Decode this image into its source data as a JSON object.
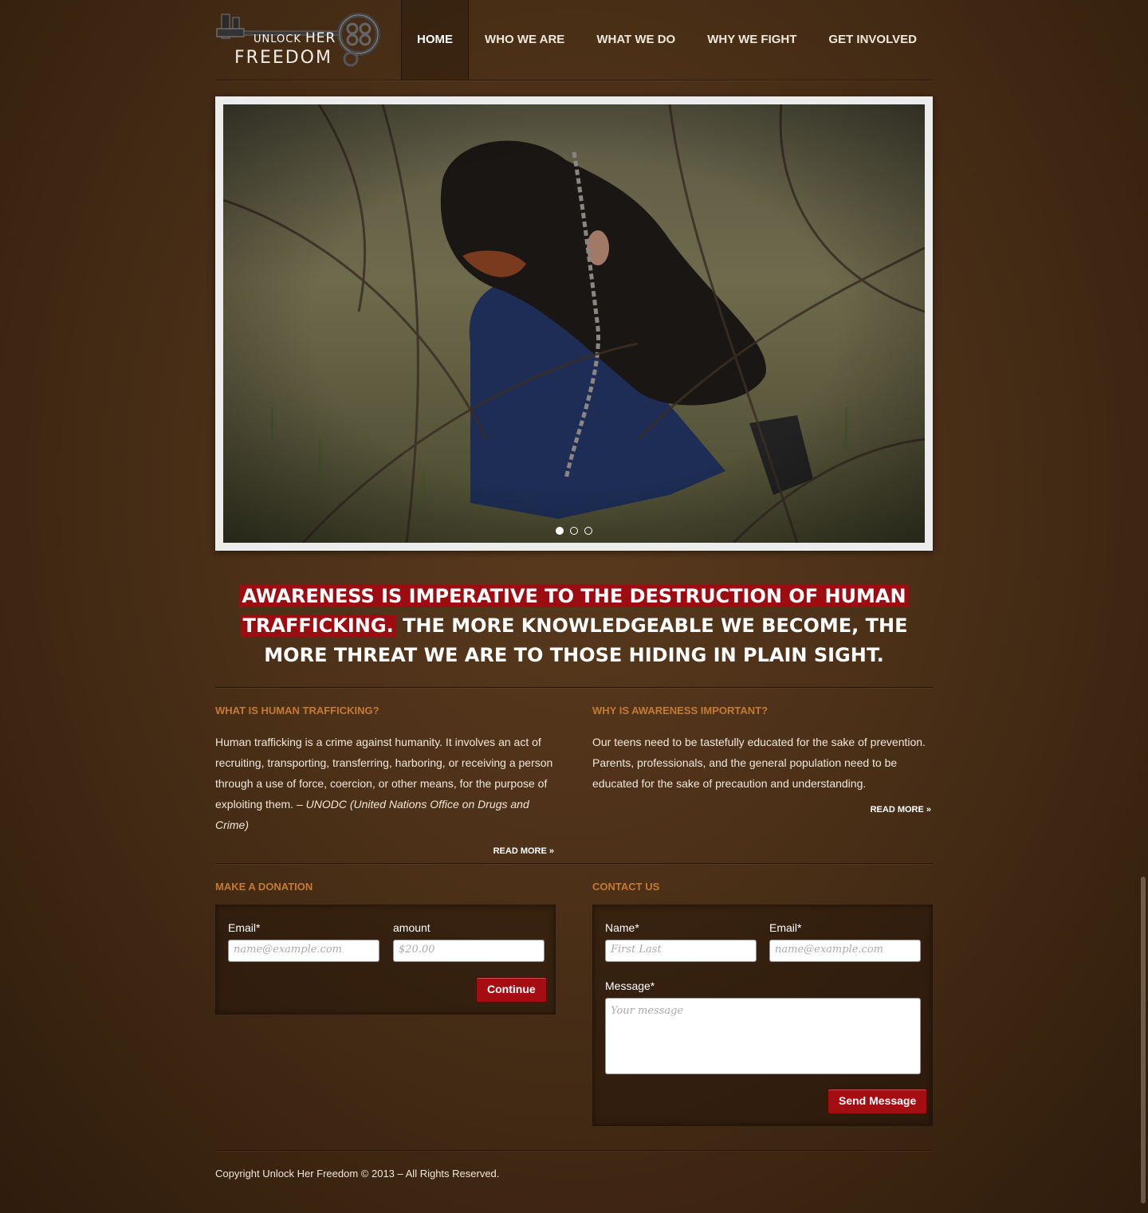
{
  "logo": {
    "unlock": "UNLOCK",
    "her": "HER",
    "freedom": "FREEDOM"
  },
  "nav": [
    {
      "label": "HOME",
      "active": true
    },
    {
      "label": "WHO WE ARE",
      "active": false
    },
    {
      "label": "WHAT WE DO",
      "active": false
    },
    {
      "label": "WHY WE FIGHT",
      "active": false
    },
    {
      "label": "GET INVOLVED",
      "active": false
    }
  ],
  "slider": {
    "slide_count": 3,
    "active_index": 0
  },
  "headline": {
    "highlight_1": "AWARENESS IS IMPERATIVE TO THE DESTRUCTION OF HUMAN",
    "highlight_2": "TRAFFICKING.",
    "rest": "THE MORE KNOWLEDGEABLE WE BECOME, THE MORE THREAT WE ARE TO THOSE HIDING IN PLAIN SIGHT."
  },
  "info": {
    "left": {
      "title": "WHAT IS HUMAN TRAFFICKING?",
      "text": "Human trafficking is a crime against humanity. It involves an act of recruiting, transporting, transferring, harboring, or receiving a person through a use of force, coercion, or other means, for the purpose of exploiting them. –",
      "citation": "UNODC (United Nations Office on Drugs and Crime)",
      "read_more": "READ MORE »"
    },
    "right": {
      "title": "WHY IS AWARENESS IMPORTANT?",
      "text": "Our teens need to be tastefully educated for the sake of prevention. Parents, professionals, and the general population need to be educated for the sake of precaution and understanding.",
      "read_more": "READ MORE »"
    }
  },
  "donation": {
    "title": "MAKE A DONATION",
    "email_label": "Email*",
    "email_placeholder": "name@example.com",
    "amount_label": "amount",
    "amount_placeholder": "$20.00",
    "button": "Continue"
  },
  "contact": {
    "title": "CONTACT US",
    "name_label": "Name*",
    "name_placeholder": "First Last",
    "email_label": "Email*",
    "email_placeholder": "name@example.com",
    "message_label": "Message*",
    "message_placeholder": "Your message",
    "button": "Send Message"
  },
  "footer": {
    "copyright": "Copyright Unlock Her Freedom © 2013 – All Rights Reserved."
  },
  "colors": {
    "accent_red": "#a50d12",
    "heading_orange": "#c47a33",
    "background_brown": "#4a2f17"
  }
}
